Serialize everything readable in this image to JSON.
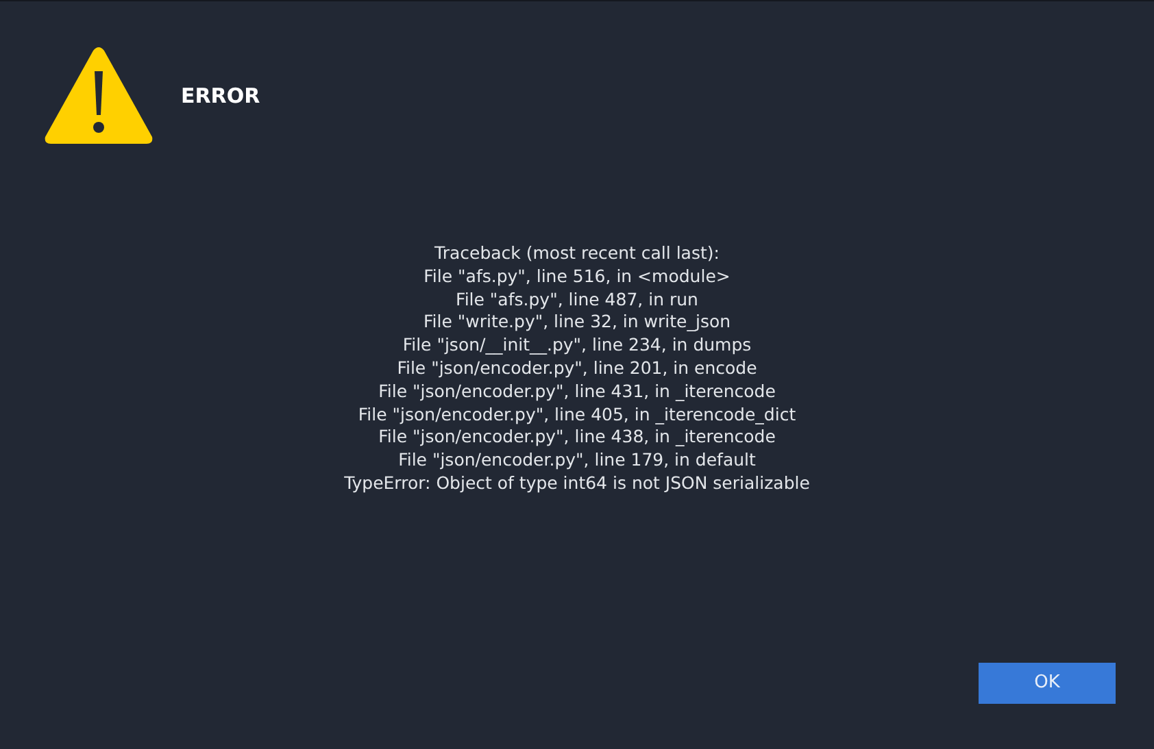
{
  "dialog": {
    "title": "ERROR",
    "message_lines": [
      "Traceback (most recent call last):",
      "File \"afs.py\", line 516, in <module>",
      "File \"afs.py\", line 487, in run",
      "File \"write.py\", line 32, in write_json",
      "File \"json/__init__.py\", line 234, in dumps",
      "File \"json/encoder.py\", line 201, in encode",
      "File \"json/encoder.py\", line 431, in _iterencode",
      "File \"json/encoder.py\", line 405, in _iterencode_dict",
      "File \"json/encoder.py\", line 438, in _iterencode",
      "File \"json/encoder.py\", line 179, in default",
      "TypeError: Object of type int64 is not JSON serializable"
    ],
    "buttons": [
      "OK"
    ]
  }
}
